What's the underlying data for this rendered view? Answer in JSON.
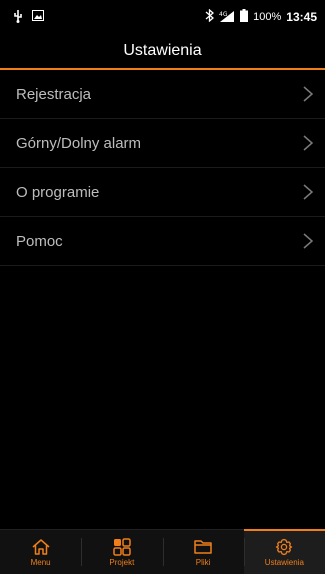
{
  "status_bar": {
    "left_icons": [
      "usb-icon",
      "image-icon"
    ],
    "right_icons": [
      "bluetooth-icon",
      "signal-4g-icon",
      "battery-icon"
    ],
    "battery": "100%",
    "time": "13:45"
  },
  "header": {
    "title": "Ustawienia"
  },
  "menu": {
    "items": [
      {
        "label": "Rejestracja"
      },
      {
        "label": "Górny/Dolny alarm"
      },
      {
        "label": "O programie"
      },
      {
        "label": "Pomoc"
      }
    ]
  },
  "bottom_nav": {
    "items": [
      {
        "label": "Menu",
        "icon": "home-icon"
      },
      {
        "label": "Projekt",
        "icon": "grid-icon"
      },
      {
        "label": "Pliki",
        "icon": "folder-icon"
      },
      {
        "label": "Ustawienia",
        "icon": "gear-icon"
      }
    ],
    "active": "Ustawienia"
  },
  "colors": {
    "accent": "#f07f1a",
    "background": "#000000",
    "text": "#bdbdbd"
  }
}
